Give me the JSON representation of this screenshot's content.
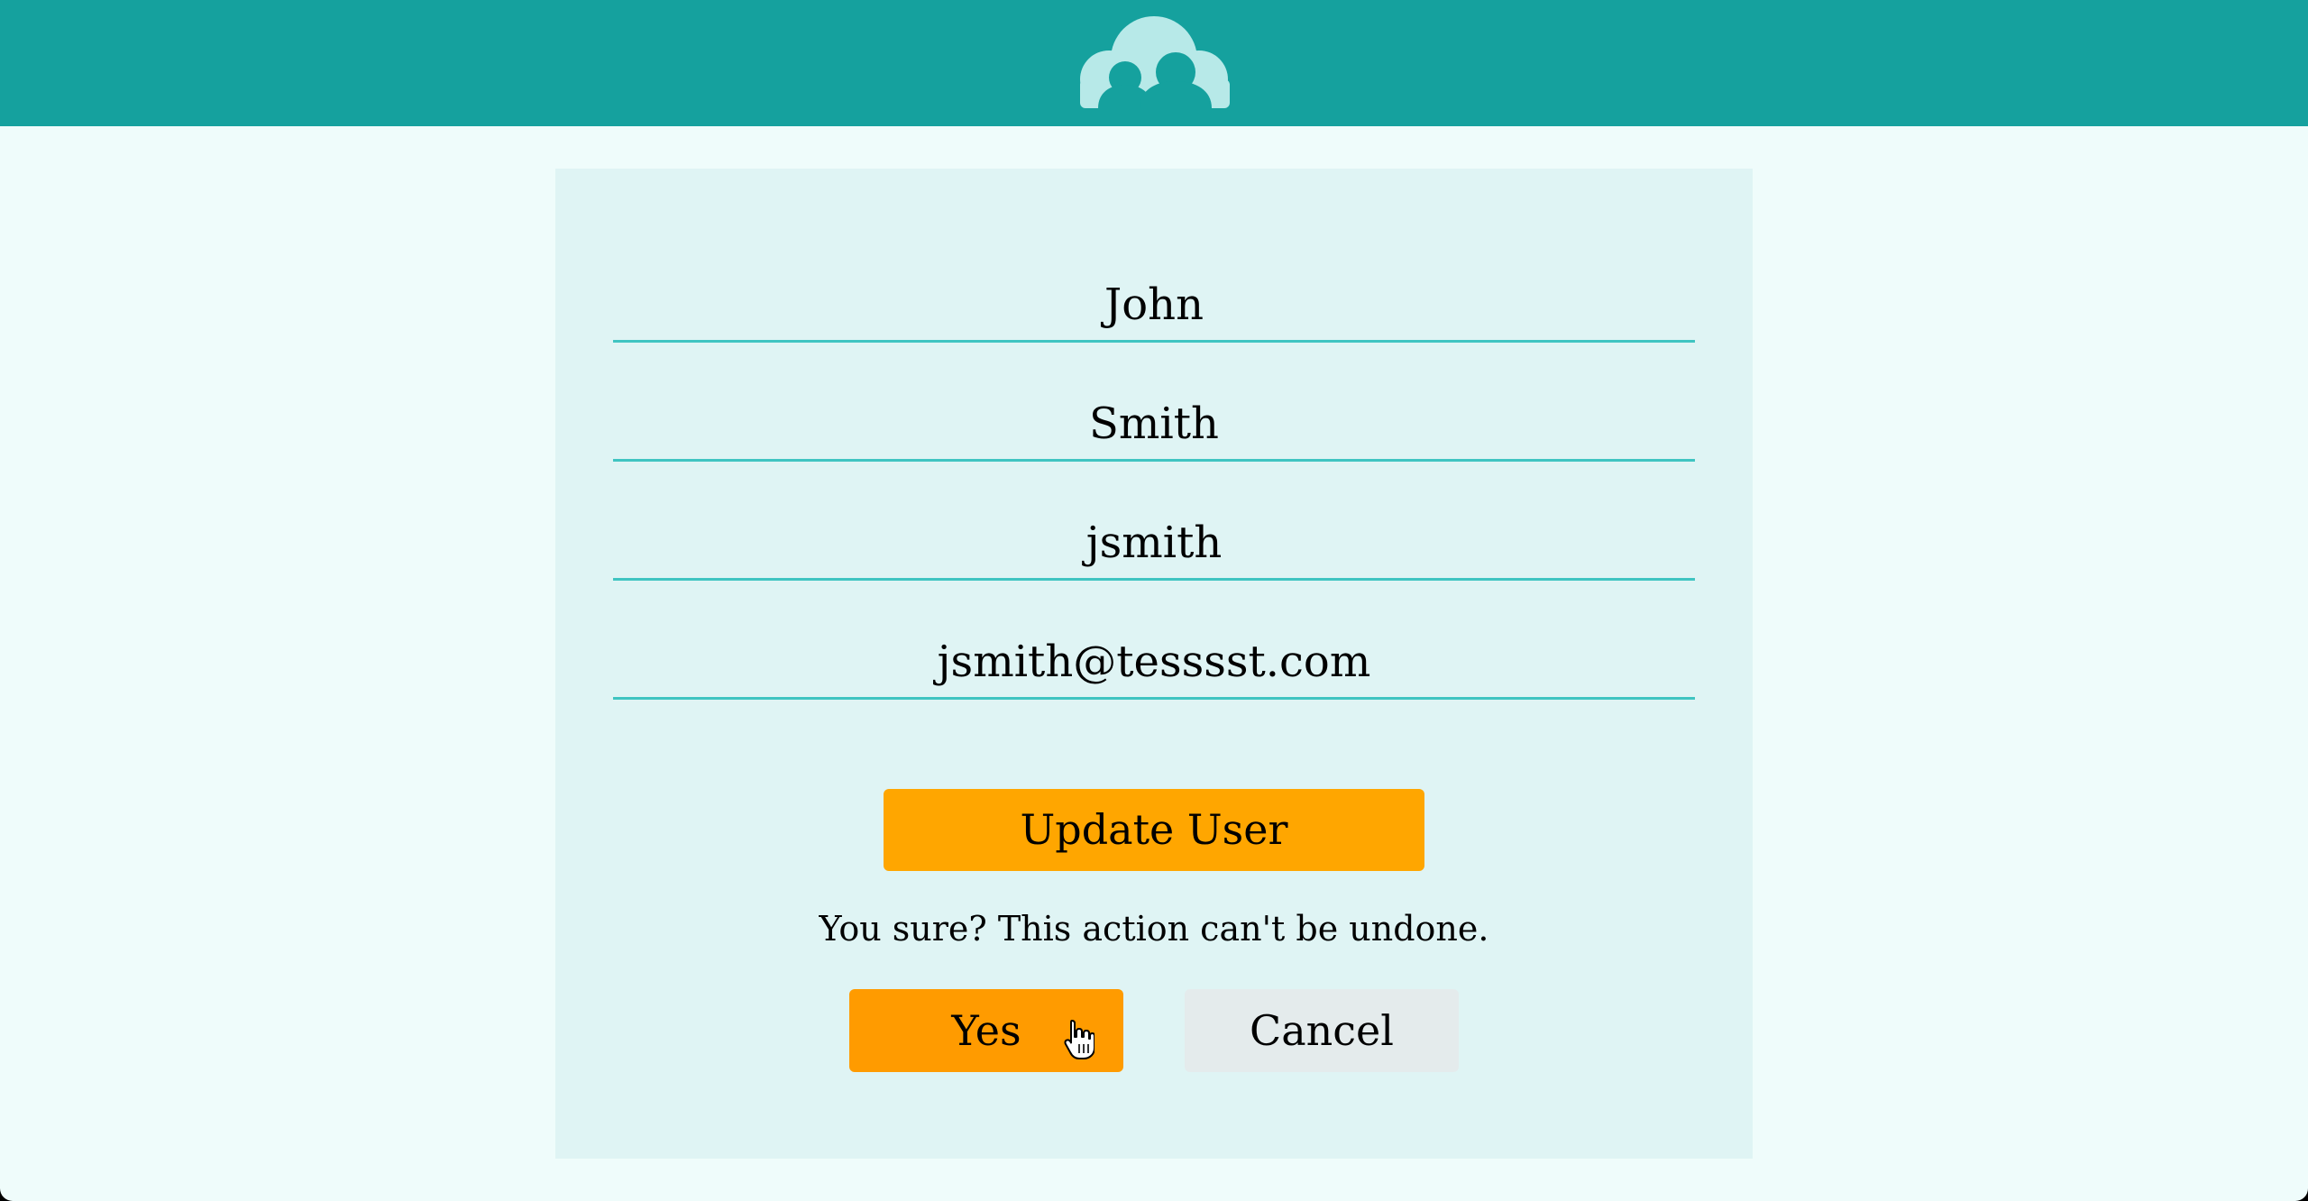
{
  "app": {
    "logo_icon": "cloud-users-logo-icon",
    "brand_color": "#15a19e",
    "background_color": "#effcfb"
  },
  "form": {
    "first_name": "John",
    "last_name": "Smith",
    "username": "jsmith",
    "email": "jsmith@tesssst.com",
    "update_button_label": "Update User",
    "confirm_message": "You sure? This action can't be undone.",
    "yes_button_label": "Yes",
    "cancel_button_label": "Cancel"
  },
  "colors": {
    "update_button": "#ffa600",
    "yes_button": "#ff9b00",
    "cancel_button": "#e4ebec",
    "field_underline": "#3fc4c1"
  },
  "cursor": {
    "icon": "pointer-hand-icon"
  }
}
